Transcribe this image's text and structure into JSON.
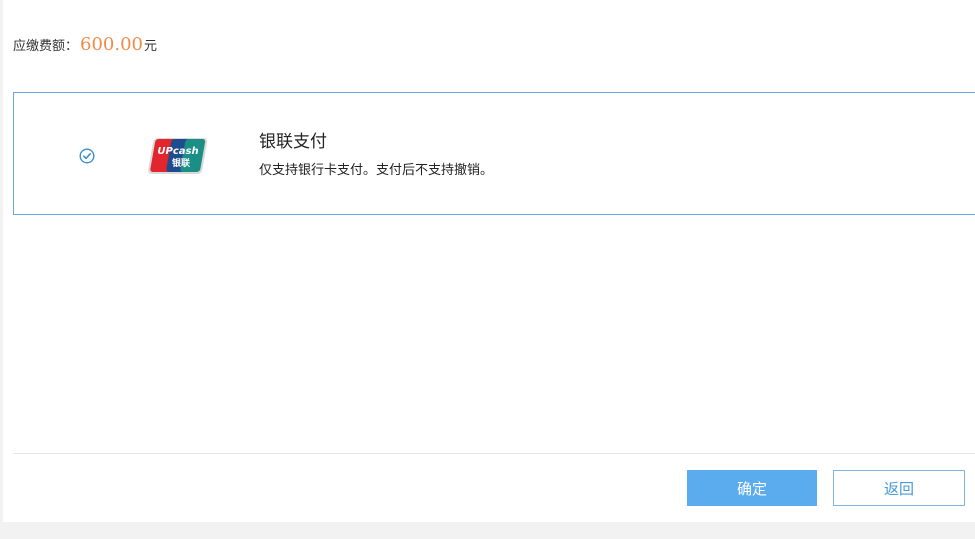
{
  "payment": {
    "amount_label": "应缴费额：",
    "amount_value": "600.00",
    "amount_unit": "元"
  },
  "option": {
    "selected": true,
    "logo_text_top": "UPcash",
    "logo_text_bottom": "银联",
    "title": "银联支付",
    "description": "仅支持银行卡支付。支付后不支持撤销。"
  },
  "footer": {
    "confirm_label": "确定",
    "back_label": "返回"
  },
  "colors": {
    "accent": "#5aacee",
    "amount": "#f28b4a",
    "border": "#6aa9d6"
  },
  "icons": {
    "check": "check-circle-icon",
    "logo": "unionpay-upcash-logo"
  }
}
